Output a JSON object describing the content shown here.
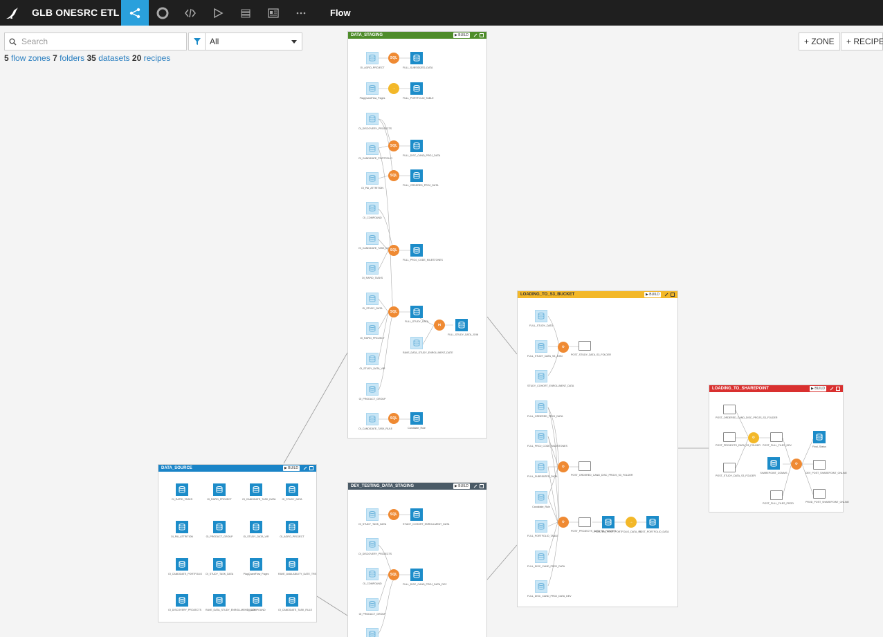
{
  "app": {
    "title": "GLB ONESRC ETL",
    "flow_label": "Flow"
  },
  "nav": {
    "icons": [
      "flow-icon",
      "lifebuoy-icon",
      "code-icon",
      "play-icon",
      "stack-icon",
      "dashboard-icon",
      "more-icon"
    ]
  },
  "search": {
    "placeholder": "Search",
    "filter_value": "All"
  },
  "summary": {
    "zones_count": "5",
    "zones_label": "flow zones",
    "folders_count": "7",
    "folders_label": "folders",
    "datasets_count": "35",
    "datasets_label": "datasets",
    "recipes_count": "20",
    "recipes_label": "recipes"
  },
  "buttons": {
    "zone": "+ ZONE",
    "recipe": "+ RECIPE"
  },
  "colors": {
    "topbar": "#1f1f1f",
    "active": "#2aa0dc",
    "staging": "#4e8c2a",
    "source": "#1a84c7",
    "s3": "#f3b829",
    "sharepoint": "#d9302f",
    "dev": "#4a5a66",
    "recipe": "#ef8a33"
  },
  "zones": {
    "staging": {
      "name": "DATA_STAGING",
      "build": "▶ BUILD"
    },
    "source": {
      "name": "DATA_SOURCE",
      "build": "▶ BUILD"
    },
    "dev": {
      "name": "DEV_TESTING_DATA_STAGING",
      "build": "▶ BUILD"
    },
    "s3": {
      "name": "LOADING_TO_S3_BUCKET",
      "build": "▶ BUILD"
    },
    "sharepoint": {
      "name": "LOADING_TO_SHAREPOINT",
      "build": "▶ BUILD"
    }
  }
}
